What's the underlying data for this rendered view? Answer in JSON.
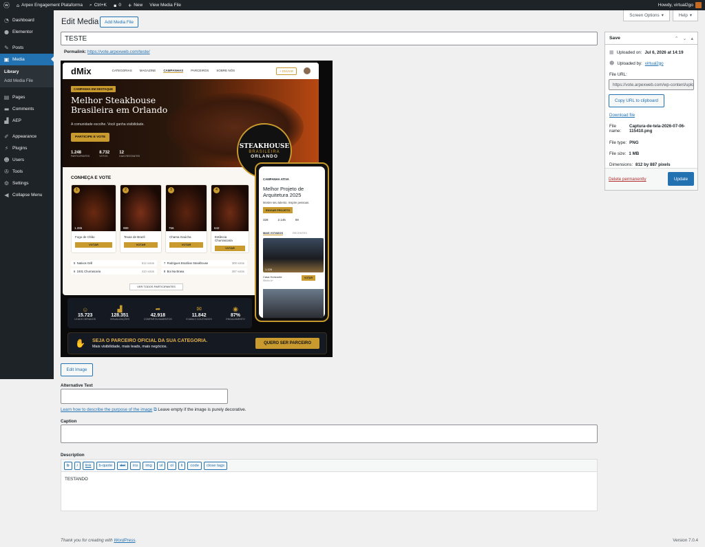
{
  "adminbar": {
    "site_name": "Arpex Engagement Plataforma",
    "search_shortcut": "Ctrl+K",
    "comments_count": "0",
    "new_label": "New",
    "view_label": "View Media File",
    "howdy": "Howdy, virtual2go"
  },
  "sidebar": {
    "items": [
      {
        "label": "Dashboard",
        "icon": "dashboard-icon"
      },
      {
        "label": "Elementor",
        "icon": "elementor-icon"
      },
      {
        "label": "Posts",
        "icon": "pin-icon"
      },
      {
        "label": "Media",
        "icon": "media-icon"
      },
      {
        "label": "Pages",
        "icon": "pages-icon"
      },
      {
        "label": "Comments",
        "icon": "comments-icon"
      },
      {
        "label": "AEP",
        "icon": "chart-icon"
      },
      {
        "label": "Appearance",
        "icon": "brush-icon"
      },
      {
        "label": "Plugins",
        "icon": "plug-icon"
      },
      {
        "label": "Users",
        "icon": "users-icon"
      },
      {
        "label": "Tools",
        "icon": "wrench-icon"
      },
      {
        "label": "Settings",
        "icon": "settings-icon"
      },
      {
        "label": "Collapse Menu",
        "icon": "collapse-icon"
      }
    ],
    "submenu": [
      "Library",
      "Add Media File"
    ]
  },
  "header": {
    "title": "Edit Media",
    "add_button": "Add Media File",
    "screen_options": "Screen Options",
    "help": "Help"
  },
  "post": {
    "title_value": "TESTE",
    "permalink_label": "Permalink:",
    "permalink_url": "https://vote.arpexweb.com/teste/"
  },
  "preview": {
    "brand": "dMix",
    "nav": [
      "CATEGORIAS",
      "MAGAZINE",
      "CAMPANHAS",
      "PARCEIROS",
      "SOBRE NÓS"
    ],
    "enviar": "+ ENVIAR",
    "badge": "CAMPANHA EM DESTAQUE",
    "headline": "Melhor Steakhouse Brasileira em Orlando",
    "subline": "A comunidade escolhe. Você ganha visibilidade.",
    "cta": "PARTICIPE E VOTE",
    "stats": [
      {
        "v": "1.248",
        "l": "PARTICIPANTES"
      },
      {
        "v": "8.732",
        "l": "VOTOS"
      },
      {
        "v": "12",
        "l": "DIAS RESTANTES"
      }
    ],
    "seal": [
      "STEAKHOUSE",
      "BRASILEIRA",
      "ORLANDO"
    ],
    "section": "CONHEÇA E VOTE",
    "cards": [
      {
        "n": "1",
        "votes": "1.285",
        "name": "Fogo de Chão"
      },
      {
        "n": "2",
        "votes": "980",
        "name": "Texas de Brazil"
      },
      {
        "n": "3",
        "votes": "756",
        "name": "Chama Gaúcha"
      },
      {
        "n": "4",
        "votes": "642",
        "name": "Estância Churrascaria"
      }
    ],
    "vote_btn": "VOTAR",
    "ranking": [
      {
        "n": "5",
        "name": "Nativos Grill",
        "v": "512 votos"
      },
      {
        "n": "6",
        "name": "1931 Churrascaria",
        "v": "410 votos"
      },
      {
        "n": "7",
        "name": "Rodrigues Brazilian Steakhouse",
        "v": "308 votos"
      },
      {
        "n": "8",
        "name": "Boi Na Brasa",
        "v": "287 votos"
      }
    ],
    "ver_todos": "VER TODOS PARTICIPANTES",
    "metrics": [
      {
        "v": "15.723",
        "l": "LEADS GERADOS"
      },
      {
        "v": "128.351",
        "l": "VISUALIZAÇÕES"
      },
      {
        "v": "42.918",
        "l": "COMPARTILHAMENTOS"
      },
      {
        "v": "11.842",
        "l": "E-MAILS COLETADOS"
      },
      {
        "v": "87%",
        "l": "ENGAJAMENTO"
      }
    ],
    "partner_title": "SEJA O PARCEIRO OFICIAL DA SUA CATEGORIA.",
    "partner_sub": "Mais visibilidade, mais leads, mais negócios.",
    "partner_btn": "QUERO SER PARCEIRO",
    "phone": {
      "badge": "CAMPANHA ATIVA",
      "title": "Melhor Projeto de Arquitetura 2025",
      "sub": "Mostre seu talento. Inspire pessoas.",
      "btn": "ENVIAR PROJETO",
      "stats": [
        "328",
        "2.145",
        "09"
      ],
      "tabs": [
        "MAIS VOTADOS",
        "RECENTES"
      ],
      "card_votes": "1.126",
      "card_name": "Casa Horizonte",
      "card_sub": "Studio A+",
      "card_btn": "VOTAR"
    }
  },
  "edit_image": "Edit Image",
  "alt": {
    "label": "Alternative Text",
    "link": "Learn how to describe the purpose of the image",
    "hint": "Leave empty if the image is purely decorative."
  },
  "caption": {
    "label": "Caption"
  },
  "description": {
    "label": "Description",
    "buttons": [
      "b",
      "i",
      "link",
      "b-quote",
      "del",
      "ins",
      "img",
      "ul",
      "ol",
      "li",
      "code",
      "close tags"
    ],
    "value": "TESTANDO"
  },
  "savebox": {
    "title": "Save",
    "uploaded_on_label": "Uploaded on:",
    "uploaded_on": "Jul 6, 2026 at 14:19",
    "uploaded_by_label": "Uploaded by:",
    "uploaded_by": "virtual2go",
    "file_url_label": "File URL:",
    "file_url": "https://vote.arpexweb.com/wp-content/uploads/2026/07/Captura-de-tela-2026-07-06-115410.png",
    "copy_btn": "Copy URL to clipboard",
    "download": "Download file",
    "file_name_label": "File name:",
    "file_name": "Captura-de-tela-2026-07-06-115410.png",
    "file_type_label": "File type:",
    "file_type": "PNG",
    "file_size_label": "File size:",
    "file_size": "1 MB",
    "dimensions_label": "Dimensions:",
    "dimensions": "812 by 887 pixels",
    "delete": "Delete permanently",
    "update": "Update"
  },
  "footer": {
    "thanks": "Thank you for creating with",
    "wp": "WordPress",
    "version": "Version 7.0.4"
  }
}
